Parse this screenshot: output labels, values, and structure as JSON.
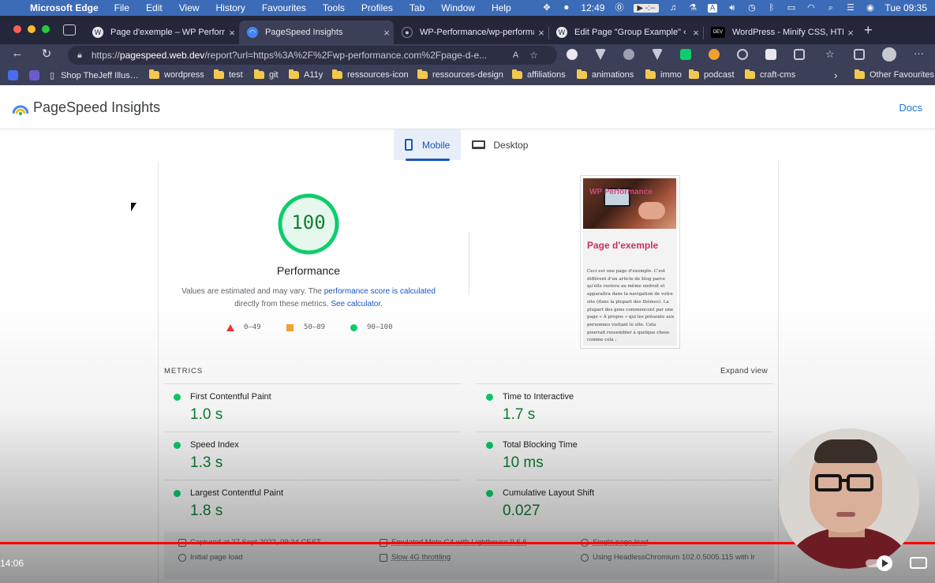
{
  "menubar": {
    "app_name": "Microsoft Edge",
    "items": [
      "File",
      "Edit",
      "View",
      "History",
      "Favourites",
      "Tools",
      "Profiles",
      "Tab",
      "Window",
      "Help"
    ],
    "clock": "12:49",
    "media_time": "-:--",
    "input_source": "A",
    "datetime": "Tue 09:35"
  },
  "tabs": [
    {
      "title": "Page d'exemple – WP Perform…",
      "favicon": "wordpress-icon"
    },
    {
      "title": "PageSpeed Insights",
      "favicon": "pagespeed-icon"
    },
    {
      "title": "WP-Performance/wp-performa…",
      "favicon": "github-icon"
    },
    {
      "title": "Edit Page \"Group Example\" ‹ n…",
      "favicon": "wordpress-icon"
    },
    {
      "title": "WordPress - Minify CSS, HTML…",
      "favicon": "dev-icon",
      "favicon_text": "DEV"
    }
  ],
  "address": {
    "url_prefix": "https://",
    "url_host": "pagespeed.web.dev",
    "url_rest": "/report?url=https%3A%2F%2Fwp-performance.com%2Fpage-d-e..."
  },
  "bookmarks": [
    {
      "label": "Shop TheJeff Illus…",
      "type": "page"
    },
    {
      "label": "wordpress",
      "type": "folder"
    },
    {
      "label": "test",
      "type": "folder"
    },
    {
      "label": "git",
      "type": "folder"
    },
    {
      "label": "A11y",
      "type": "folder"
    },
    {
      "label": "ressources-icon",
      "type": "folder"
    },
    {
      "label": "ressources-design",
      "type": "folder"
    },
    {
      "label": "affiliations",
      "type": "folder"
    },
    {
      "label": "animations",
      "type": "folder"
    },
    {
      "label": "immo",
      "type": "folder"
    },
    {
      "label": "podcast",
      "type": "folder"
    },
    {
      "label": "craft-cms",
      "type": "folder"
    }
  ],
  "bookmarks_other": "Other Favourites",
  "psi": {
    "title": "PageSpeed Insights",
    "docs_link": "Docs",
    "mode_tabs": [
      "Mobile",
      "Desktop"
    ],
    "active_mode": "Mobile",
    "score": "100",
    "score_fraction": 1.0,
    "category": "Performance",
    "desc_1": "Values are estimated and may vary. The ",
    "desc_link_1": "performance score is calculated",
    "desc_2": "directly from these metrics. ",
    "desc_link_2": "See calculator.",
    "legend": [
      "0–49",
      "50–89",
      "90–100"
    ],
    "colors": {
      "pass": "#0cce6b",
      "average": "#f5a430",
      "fail": "#e53935",
      "score_text": "#0d7e33"
    },
    "screenshot": {
      "brand": "WP Performance",
      "heading": "Page d'exemple",
      "text": "Ceci est une page d'exemple. C'est différent d'un article de blog parce qu'elle restera au même endroit et apparaîtra dans la navigation de votre site (dans la plupart des thèmes). La plupart des gens commencent par une page « À propos » qui les présente aux personnes visitant le site. Cela pourrait ressembler à quelque chose comme cela :"
    },
    "metrics_heading": "METRICS",
    "expand_view": "Expand view",
    "metrics": [
      {
        "name": "First Contentful Paint",
        "value": "1.0 s"
      },
      {
        "name": "Time to Interactive",
        "value": "1.7 s"
      },
      {
        "name": "Speed Index",
        "value": "1.3 s"
      },
      {
        "name": "Total Blocking Time",
        "value": "10 ms"
      },
      {
        "name": "Largest Contentful Paint",
        "value": "1.8 s"
      },
      {
        "name": "Cumulative Layout Shift",
        "value": "0.027"
      }
    ],
    "info": [
      "Captured at 27 Sept 2022, 09:34 CEST",
      "Emulated Moto G4 with Lighthouse 9.6.6",
      "Single page load",
      "Initial page load",
      "Slow 4G throttling",
      "Using HeadlessChromium 102.0.5005.115 with lr"
    ]
  },
  "video": {
    "time": "14:06",
    "progress_fraction": 1.0
  }
}
